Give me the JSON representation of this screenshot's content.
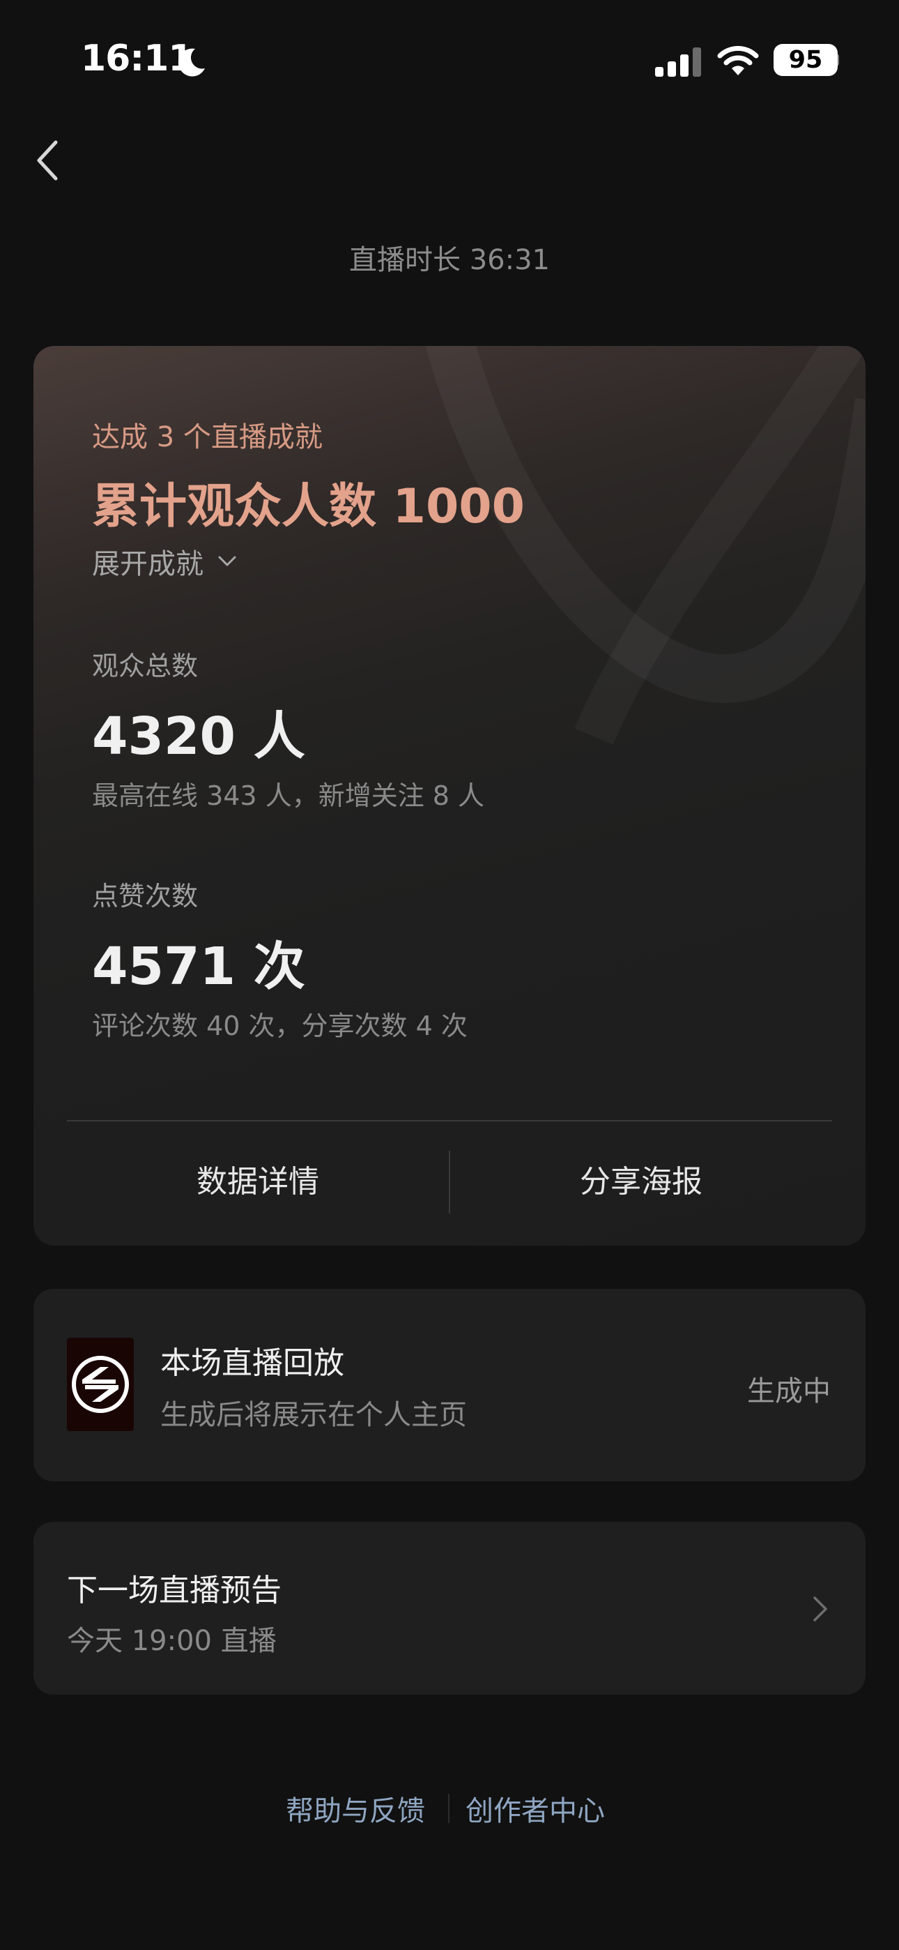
{
  "status_bar": {
    "time": "16:11",
    "battery": "95"
  },
  "header": {
    "duration": "直播时长 36:31"
  },
  "achievement": {
    "subtitle": "达成 3 个直播成就",
    "title": "累计观众人数 1000",
    "expand_label": "展开成就"
  },
  "stats": [
    {
      "label": "观众总数",
      "value": "4320 人",
      "sub": "最高在线 343 人，新增关注 8 人"
    },
    {
      "label": "点赞次数",
      "value": "4571 次",
      "sub": "评论次数 40 次，分享次数 4 次"
    }
  ],
  "actions": {
    "details_label": "数据详情",
    "share_label": "分享海报"
  },
  "replay": {
    "title": "本场直播回放",
    "subtitle": "生成后将展示在个人主页",
    "status": "生成中"
  },
  "next_live": {
    "title": "下一场直播预告",
    "subtitle": "今天 19:00 直播"
  },
  "footer": {
    "help_label": "帮助与反馈",
    "creator_label": "创作者中心"
  },
  "colors": {
    "background": "#111111",
    "achievement_accent": "#e3a28b",
    "link": "#8fa6c2"
  }
}
